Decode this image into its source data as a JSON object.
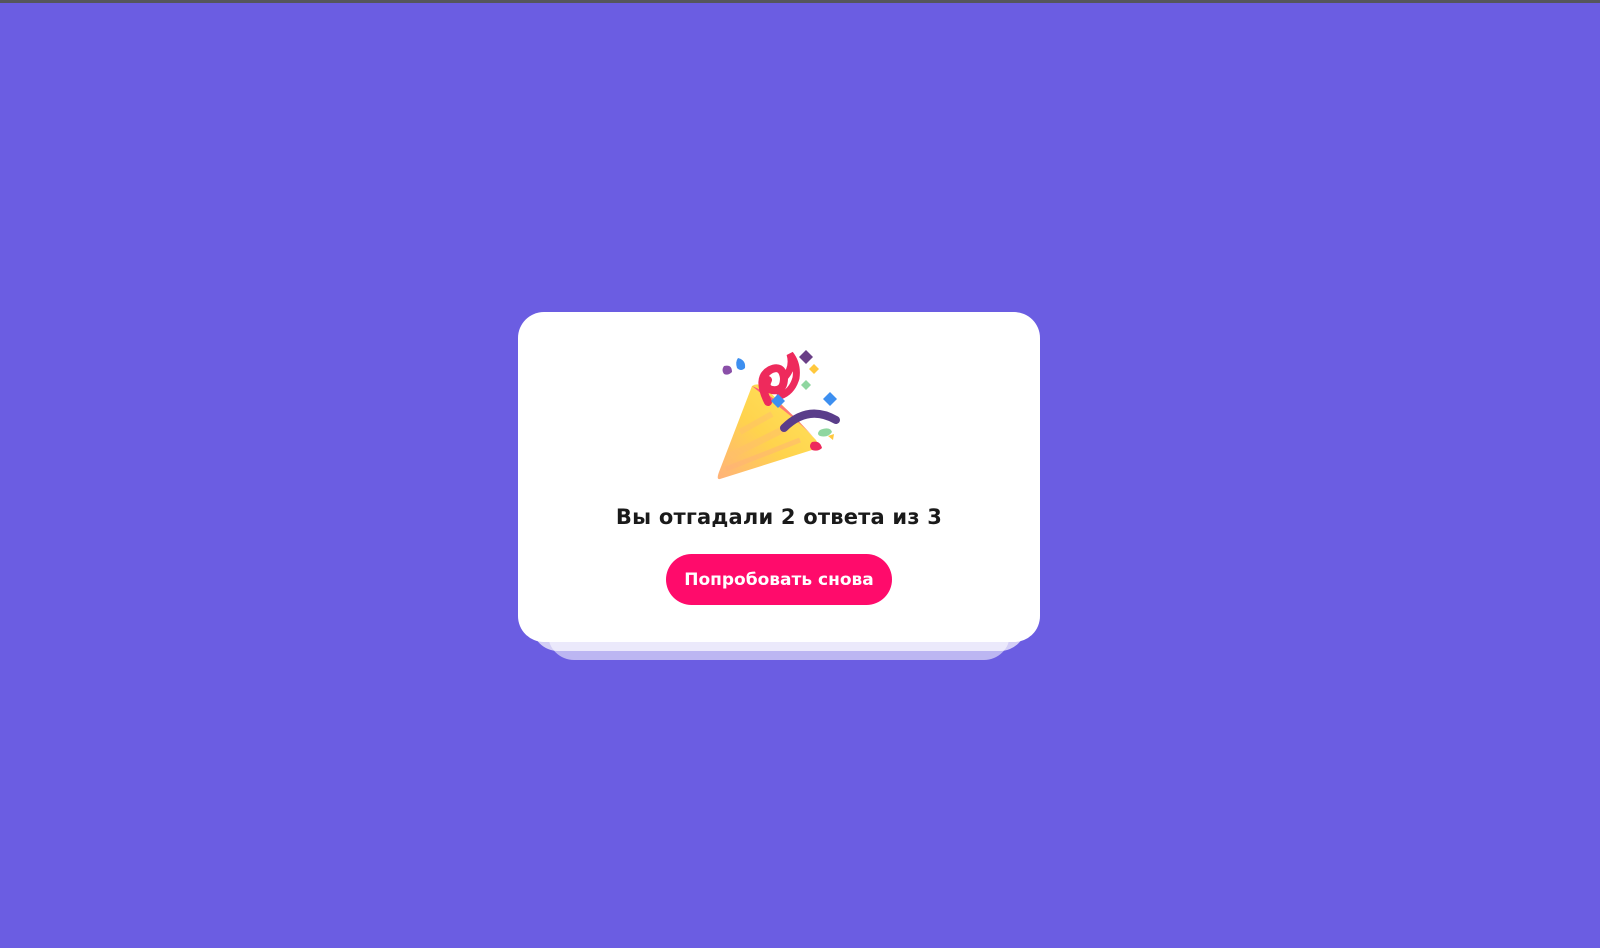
{
  "page": {
    "background_color": "#6b5de2"
  },
  "result_card": {
    "icon": "party-popper-icon",
    "message": "Вы отгадали 2 ответа из 3",
    "retry_button_label": "Попробовать снова",
    "accent_color": "#ff0b6b"
  }
}
